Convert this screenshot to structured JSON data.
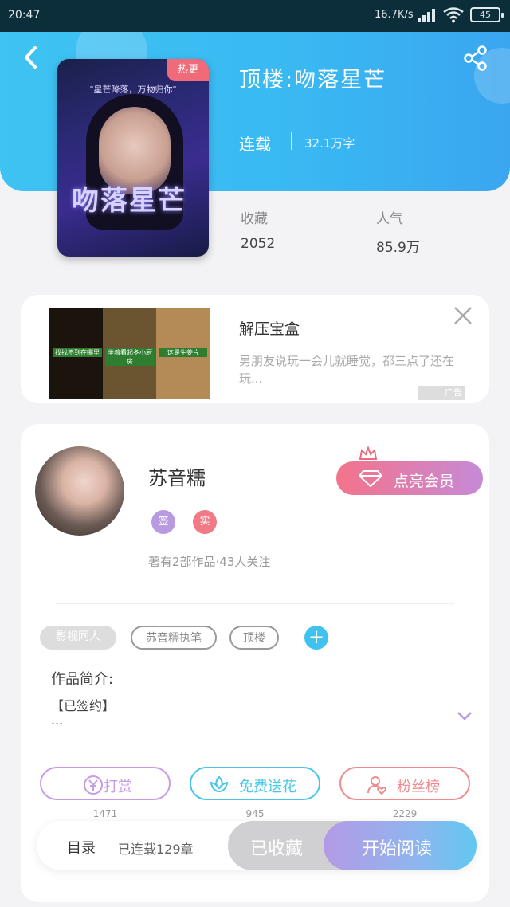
{
  "status_bar": {
    "time": "20:47",
    "speed": "16.7K/s",
    "battery": "45"
  },
  "book": {
    "title": "顶楼:吻落星芒",
    "hot_tag": "热更",
    "cover_quote": "\"星芒降落，万物归你\"",
    "cover_title": "吻落星芒",
    "status": "连载",
    "word_count": "32.1万字",
    "favorites_label": "收藏",
    "favorites_value": "2052",
    "popularity_label": "人气",
    "popularity_value": "85.9万"
  },
  "ad": {
    "title": "解压宝盒",
    "description": "男朋友说玩一会儿就睡觉，都三点了还在玩...",
    "badge": "广告",
    "panels": [
      "找找不到在哪里",
      "坐着看起冬小厨房",
      "这是生姜片"
    ]
  },
  "author": {
    "name": "苏音糯",
    "badges": [
      {
        "text": "签",
        "color": "#b79ae0"
      },
      {
        "text": "实",
        "color": "#f07b86"
      }
    ],
    "vip_label": "点亮会员",
    "meta": "著有2部作品·43人关注",
    "tags": [
      "影视同人",
      "苏音糯执笔",
      "顶楼"
    ],
    "intro_label": "作品简介:",
    "intro_text": "【已签约】",
    "intro_more": "...",
    "actions": [
      {
        "label": "打赏",
        "count": "1471",
        "color": "#c79be6"
      },
      {
        "label": "免费送花",
        "count": "945",
        "color": "#46c7ea"
      },
      {
        "label": "粉丝榜",
        "count": "2229",
        "color": "#ef8a8e"
      }
    ]
  },
  "bottom_bar": {
    "toc_label": "目录",
    "toc_count": "已连载129章",
    "favorited_label": "已收藏",
    "read_label": "开始阅读"
  },
  "icons": {
    "back": "back-arrow-icon",
    "share": "share-icon",
    "close": "close-icon",
    "diamond": "diamond-icon",
    "crown": "crown-icon",
    "yen": "yen-coin-icon",
    "flower": "flower-icon",
    "fans": "fans-icon",
    "chevron": "chevron-down-icon"
  }
}
